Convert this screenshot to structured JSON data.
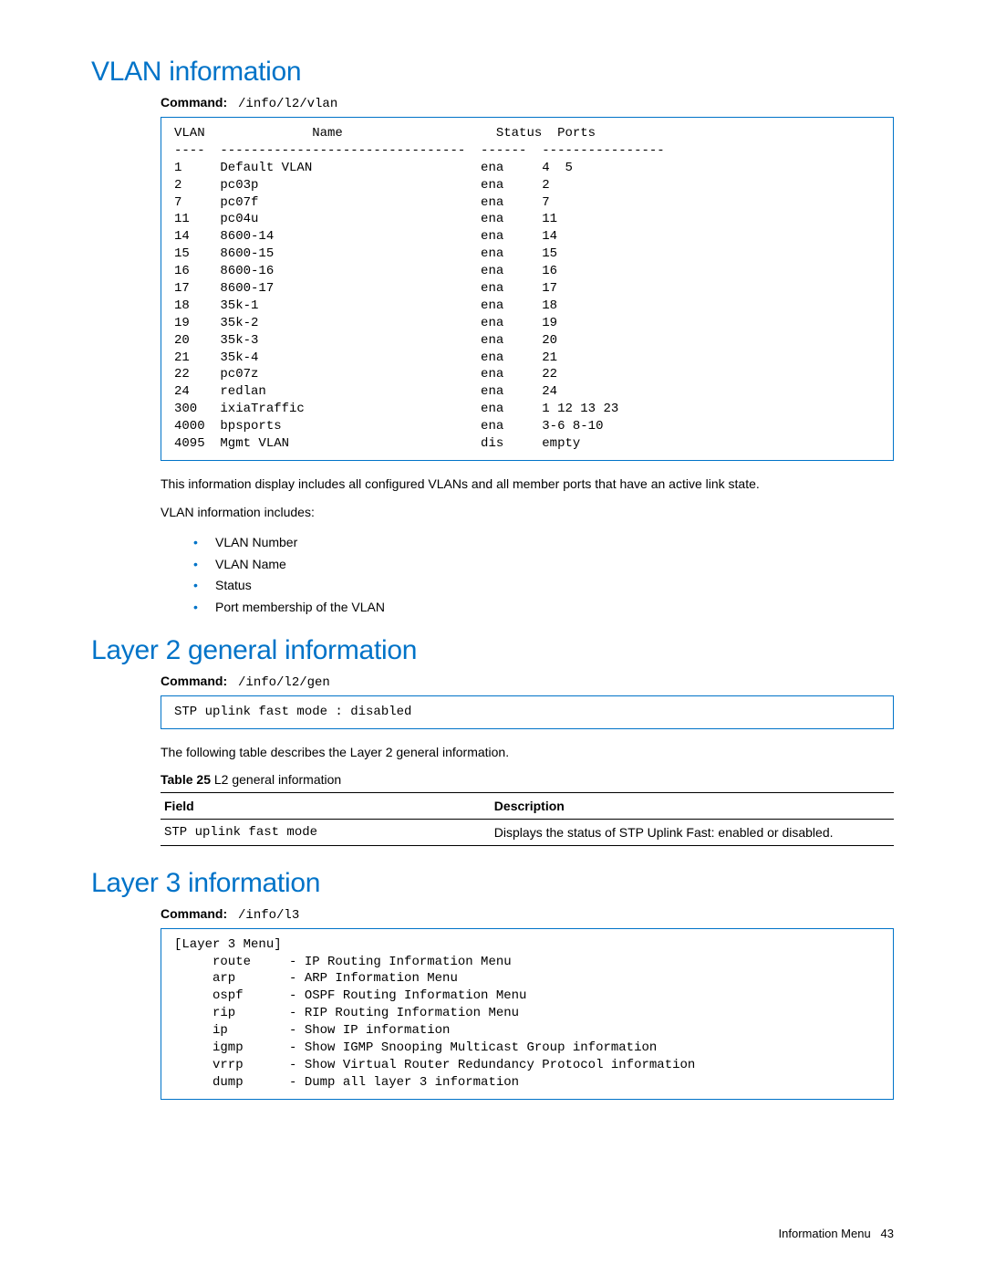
{
  "section1": {
    "heading": "VLAN information",
    "command_label": "Command:",
    "command": "/info/l2/vlan",
    "code": "VLAN              Name                    Status  Ports\n----  --------------------------------  ------  ----------------\n1     Default VLAN                      ena     4  5\n2     pc03p                             ena     2\n7     pc07f                             ena     7\n11    pc04u                             ena     11\n14    8600-14                           ena     14\n15    8600-15                           ena     15\n16    8600-16                           ena     16\n17    8600-17                           ena     17\n18    35k-1                             ena     18\n19    35k-2                             ena     19\n20    35k-3                             ena     20\n21    35k-4                             ena     21\n22    pc07z                             ena     22\n24    redlan                            ena     24\n300   ixiaTraffic                       ena     1 12 13 23\n4000  bpsports                          ena     3-6 8-10\n4095  Mgmt VLAN                         dis     empty",
    "para1": "This information display includes all configured VLANs and all member ports that have an active link state.",
    "para2": "VLAN information includes:",
    "bullets": [
      "VLAN Number",
      "VLAN Name",
      "Status",
      "Port membership of the VLAN"
    ]
  },
  "section2": {
    "heading": "Layer 2 general information",
    "command_label": "Command:",
    "command": "/info/l2/gen",
    "code": "STP uplink fast mode : disabled",
    "para1": "The following table describes the Layer 2 general information.",
    "table_caption_label": "Table 25",
    "table_caption_text": "  L2 general information",
    "headers": {
      "field": "Field",
      "desc": "Description"
    },
    "row": {
      "field": "STP uplink fast mode",
      "desc": "Displays the status of STP Uplink Fast: enabled or disabled."
    }
  },
  "section3": {
    "heading": "Layer 3 information",
    "command_label": "Command:",
    "command": "/info/l3",
    "code": "[Layer 3 Menu]\n     route     - IP Routing Information Menu\n     arp       - ARP Information Menu\n     ospf      - OSPF Routing Information Menu\n     rip       - RIP Routing Information Menu\n     ip        - Show IP information\n     igmp      - Show IGMP Snooping Multicast Group information\n     vrrp      - Show Virtual Router Redundancy Protocol information\n     dump      - Dump all layer 3 information"
  },
  "footer": {
    "section": "Information Menu",
    "page": "43"
  }
}
